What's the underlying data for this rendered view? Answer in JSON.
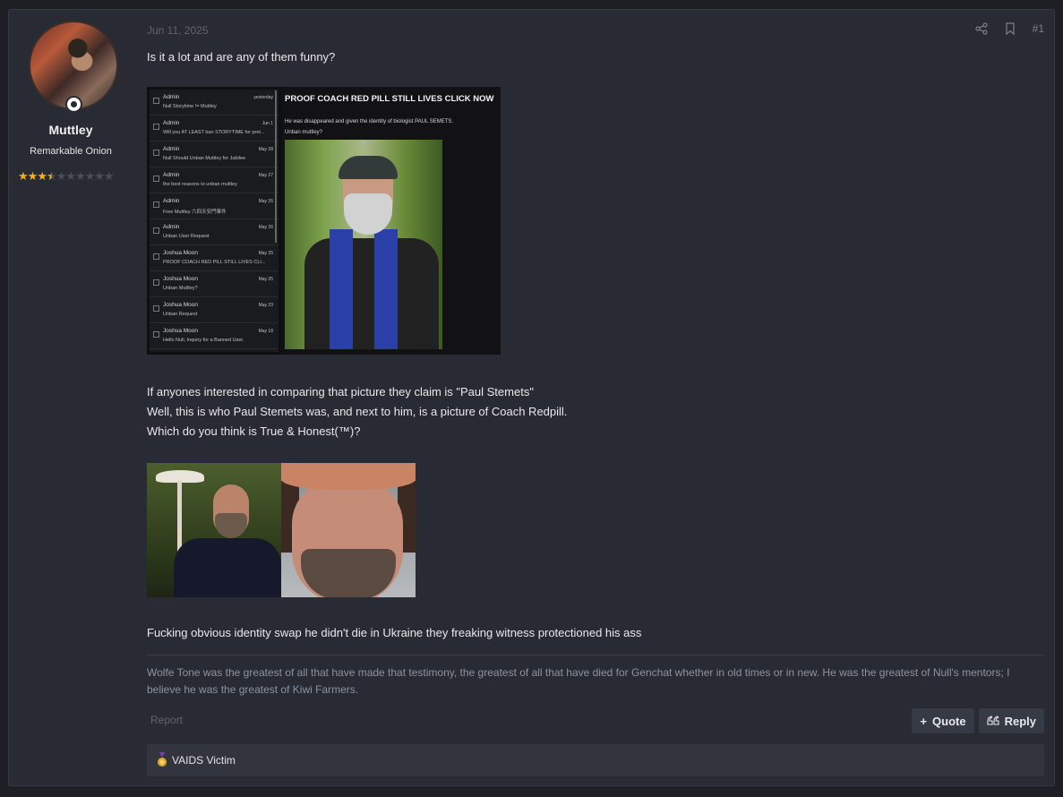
{
  "user": {
    "name": "Muttley",
    "title": "Remarkable Onion",
    "stars_filled": 3.5,
    "stars_total": 10
  },
  "post": {
    "date": "Jun 11, 2025",
    "number": "#1",
    "line1": "Is it a lot and are any of them funny?",
    "line2": "If anyones interested in comparing that picture they claim is \"Paul Stemets\"",
    "line3": "Well, this is who Paul Stemets was, and next to him, is a picture of Coach Redpill.",
    "line4": "Which do you think is True & Honest(™)?",
    "line5": "Fucking obvious identity swap he didn't die in Ukraine they freaking witness protectioned his ass"
  },
  "inbox": [
    {
      "sender": "Admin",
      "subject": "Null Storytime != Muttley",
      "date": "yesterday"
    },
    {
      "sender": "Admin",
      "subject": "Will you AT LEAST ban STORYTIME for pret...",
      "date": "Jun 1"
    },
    {
      "sender": "Admin",
      "subject": "Null Should Unban Muttley for Jubilee",
      "date": "May 28"
    },
    {
      "sender": "Admin",
      "subject": "the best reasons to unban muttley",
      "date": "May 27"
    },
    {
      "sender": "Admin",
      "subject": "Free Muttley 六四天安門事件",
      "date": "May 26"
    },
    {
      "sender": "Admin",
      "subject": "Unban User Request",
      "date": "May 26"
    },
    {
      "sender": "Joshua Moon",
      "subject": "PROOF COACH RED PILL STILL LIVES CLI...",
      "date": "May 25"
    },
    {
      "sender": "Joshua Moon",
      "subject": "Unban Muttley?",
      "date": "May 25"
    },
    {
      "sender": "Joshua Moon",
      "subject": "Unban Request",
      "date": "May 23"
    },
    {
      "sender": "Joshua Moon",
      "subject": "Hello Null, Inquiry for a Banned User.",
      "date": "May 18"
    }
  ],
  "proof": {
    "title": "PROOF COACH RED PILL STILL LIVES CLICK NOW",
    "line1": "He was disappeared and given the identity of biologist PAUL SEMETS.",
    "line2": "Unban muttley?"
  },
  "signature": "Wolfe Tone was the greatest of all that have made that testimony, the greatest of all that have died for Genchat whether in old times or in new. He was the greatest of Null's mentors; I believe he was the greatest of Kiwi Farmers.",
  "actions": {
    "report": "Report",
    "quote": "Quote",
    "reply": "Reply"
  },
  "reaction": {
    "name": "VAIDS Victim"
  },
  "colors": {
    "background": "#1d1f24",
    "panel": "#282b33",
    "star": "#f2b01e",
    "signature": "#8a93a3"
  }
}
